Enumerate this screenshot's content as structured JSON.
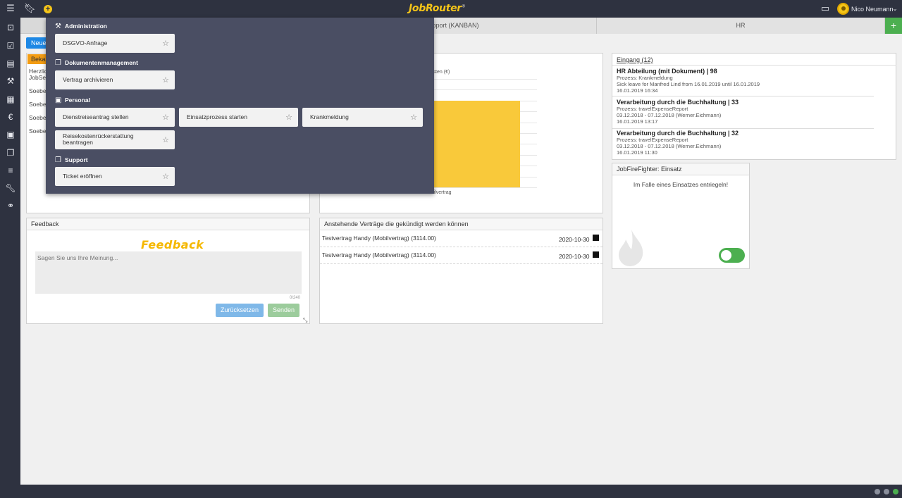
{
  "app": {
    "logo": "JobRouter",
    "logo_mark": "®",
    "user_name": "Nico Neumann"
  },
  "topbar_icons": [
    "menu-icon",
    "bookmark-icon",
    "plus-circle-icon",
    "clipboard-icon",
    "chevron-down-icon"
  ],
  "tabs": [
    {
      "label": "pport (KANBAN)"
    },
    {
      "label": "HR"
    }
  ],
  "tab_add_label": "+",
  "new_button_label": "Neue",
  "news_panel": {
    "orange_tab_label": "Beka",
    "lines": [
      "Herzlic",
      "JobSel",
      "Soeber",
      "Soeber",
      "Soeber",
      "Soeber"
    ]
  },
  "chart_panel": {
    "ylabel_fragment": "Kosten (€)",
    "chart_data": {
      "type": "bar",
      "categories": [
        "Mobilvertrag"
      ],
      "values": [
        1
      ],
      "ylabel": "Kosten (€)",
      "ylim": [
        0,
        1.25
      ]
    }
  },
  "inbox": {
    "title": "Eingang (12)",
    "items": [
      {
        "title": "HR Abteilung (mit Dokument) | 98",
        "line1": "Prozess: Krankmeldung",
        "line2": "Sick leave for Manfred Lind from 16.01.2019 until 16.01.2019",
        "line3": "16.01.2019 16:34"
      },
      {
        "title": "Verarbeitung durch die Buchhaltung | 33",
        "line1": "Prozess: travelExpenseReport",
        "line2": "03.12.2018 - 07.12.2018 (Werner.Eichmann)",
        "line3": "16.01.2019 13:17"
      },
      {
        "title": "Verarbeitung durch die Buchhaltung | 32",
        "line1": "Prozess: travelExpenseReport",
        "line2": "03.12.2018 - 07.12.2018 (Werner.Eichmann)",
        "line3": "16.01.2019 11:30"
      }
    ]
  },
  "firefighter": {
    "title": "JobFireFighter: Einsatz",
    "message": "Im Falle eines Einsatzes entriegeln!"
  },
  "feedback": {
    "title": "Feedback",
    "heading": "Feedback",
    "placeholder": "Sagen Sie uns Ihre Meinung...",
    "counter": "0/240",
    "reset_label": "Zurücksetzen",
    "send_label": "Senden"
  },
  "contracts": {
    "title": "Anstehende Verträge die gekündigt werden können",
    "rows": [
      {
        "name": "Testvertrag Handy (Mobilvertrag) (3114.00)",
        "date": "2020-10-30"
      },
      {
        "name": "Testvertrag Handy (Mobilvertrag) (3114.00)",
        "date": "2020-10-30"
      }
    ]
  },
  "menu": {
    "sections": [
      {
        "heading": "Administration",
        "items": [
          "DSGVO-Anfrage"
        ]
      },
      {
        "heading": "Dokumentenmanagement",
        "items": [
          "Vertrag archivieren"
        ]
      },
      {
        "heading": "Personal",
        "items": [
          "Dienstreiseantrag stellen",
          "Einsatzprozess starten",
          "Krankmeldung",
          "Reisekostenrückerstattung beantragen"
        ]
      },
      {
        "heading": "Support",
        "items": [
          "Ticket eröffnen"
        ]
      }
    ]
  }
}
